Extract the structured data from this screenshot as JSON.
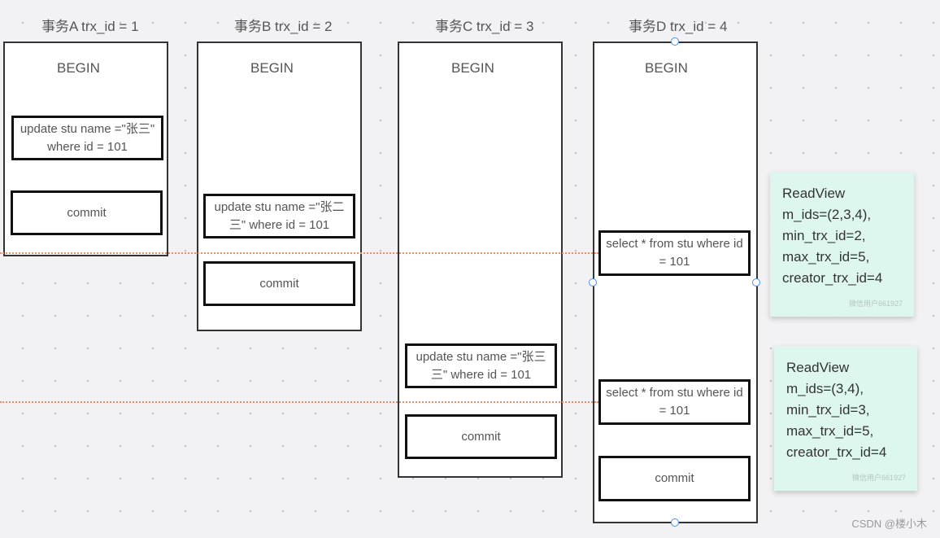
{
  "transactions": [
    {
      "title": "事务A  trx_id = 1",
      "begin": "BEGIN",
      "steps": [
        "update stu name =\"张三\" where id = 101",
        "commit"
      ]
    },
    {
      "title": "事务B  trx_id = 2",
      "begin": "BEGIN",
      "steps": [
        "update stu name =\"张二三\" where id = 101",
        "commit"
      ]
    },
    {
      "title": "事务C  trx_id = 3",
      "begin": "BEGIN",
      "steps": [
        "update stu name =\"张三三\" where id = 101",
        "commit"
      ]
    },
    {
      "title": "事务D  trx_id = 4",
      "begin": "BEGIN",
      "steps": [
        "select * from stu where id = 101",
        "select * from stu where id = 101",
        "commit"
      ]
    }
  ],
  "readviews": [
    {
      "lines": [
        "ReadView",
        "m_ids=(2,3,4),",
        "min_trx_id=2,",
        "max_trx_id=5,",
        "creator_trx_id=4"
      ],
      "watermark": "微信用户661927"
    },
    {
      "lines": [
        "ReadView",
        "m_ids=(3,4),",
        "min_trx_id=3,",
        "max_trx_id=5,",
        "creator_trx_id=4"
      ],
      "watermark": "微信用户661927"
    }
  ],
  "colors": {
    "dashed_line": "#f08a6c",
    "note_bg": "#ddf7ef",
    "handle": "#4a90e2"
  },
  "footer": {
    "credit": "CSDN @楼小木"
  }
}
